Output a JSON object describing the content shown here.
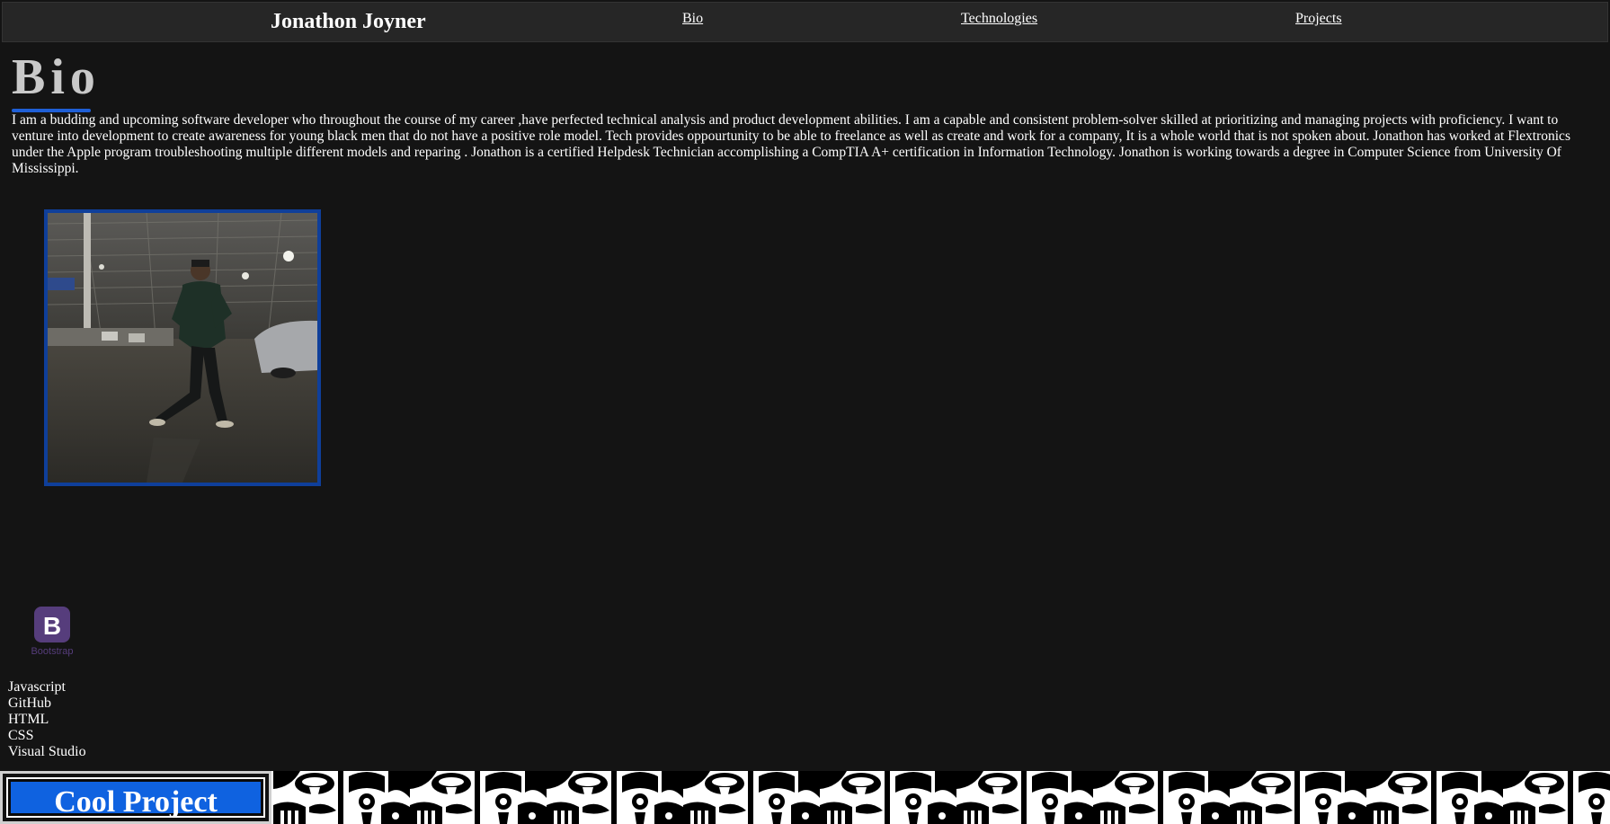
{
  "header": {
    "brand": "Jonathon Joyner",
    "nav": {
      "bio": "Bio",
      "technologies": "Technologies",
      "projects": "Projects"
    }
  },
  "bio": {
    "heading": "Bio",
    "text": "I am a budding and upcoming software developer who throughout the course of my career ,have perfected technical analysis and product development abilities. I am a capable and consistent problem-solver skilled at prioritizing and managing projects with proficiency. I want to venture into development to create awareness for young black men that do not have a positive role model. Tech provides oppourtunity to be able to freelance as well as create and work for a company, It is a whole world that is not spoken about. Jonathon has worked at Flextronics under the Apple program troubleshooting multiple different models and reparing . Jonathon is a certified Helpdesk Technician accomplishing a CompTIA A+ certification in Information Technology. Jonathon is working towards a degree in Computer Science from University Of Mississippi."
  },
  "technologies": {
    "logo_caption": "Bootstrap",
    "logo_letter": "B",
    "items": [
      "Javascript",
      "GitHub",
      "HTML",
      "CSS",
      "Visual Studio"
    ]
  },
  "projects": {
    "card_title": "Cool Project"
  },
  "colors": {
    "background": "#141414",
    "navbar": "#262626",
    "accent_blue": "#1f5fd6",
    "photo_border": "#0f3f9a",
    "bootstrap_purple": "#563d7c",
    "project_button": "#0f62e0"
  }
}
